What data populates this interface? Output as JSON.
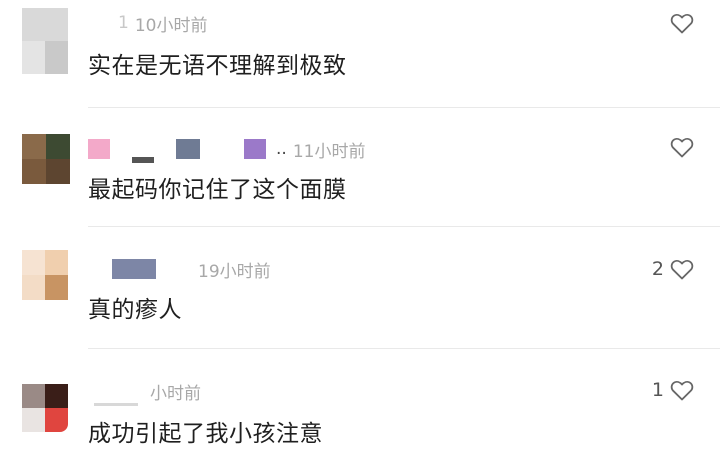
{
  "comments": [
    {
      "time_prefix": "1",
      "time": "10小时前",
      "text": "实在是无语不理解到极致",
      "like_count": "",
      "liked": false
    },
    {
      "time_prefix": "..",
      "time": "11小时前",
      "text": "最起码你记住了这个面膜",
      "like_count": "",
      "liked": false
    },
    {
      "time_prefix": "",
      "time": "19小时前",
      "text": "真的瘆人",
      "like_count": "2",
      "liked": false
    },
    {
      "time_prefix": "",
      "time": "小时前",
      "text": "成功引起了我小孩注意",
      "like_count": "1",
      "liked": false
    }
  ],
  "icons": {
    "like": "heart-outline-icon"
  },
  "colors": {
    "text": "#1f1f1f",
    "meta": "#a8a8a8",
    "icon": "#666666",
    "divider": "#e9e9e9"
  }
}
